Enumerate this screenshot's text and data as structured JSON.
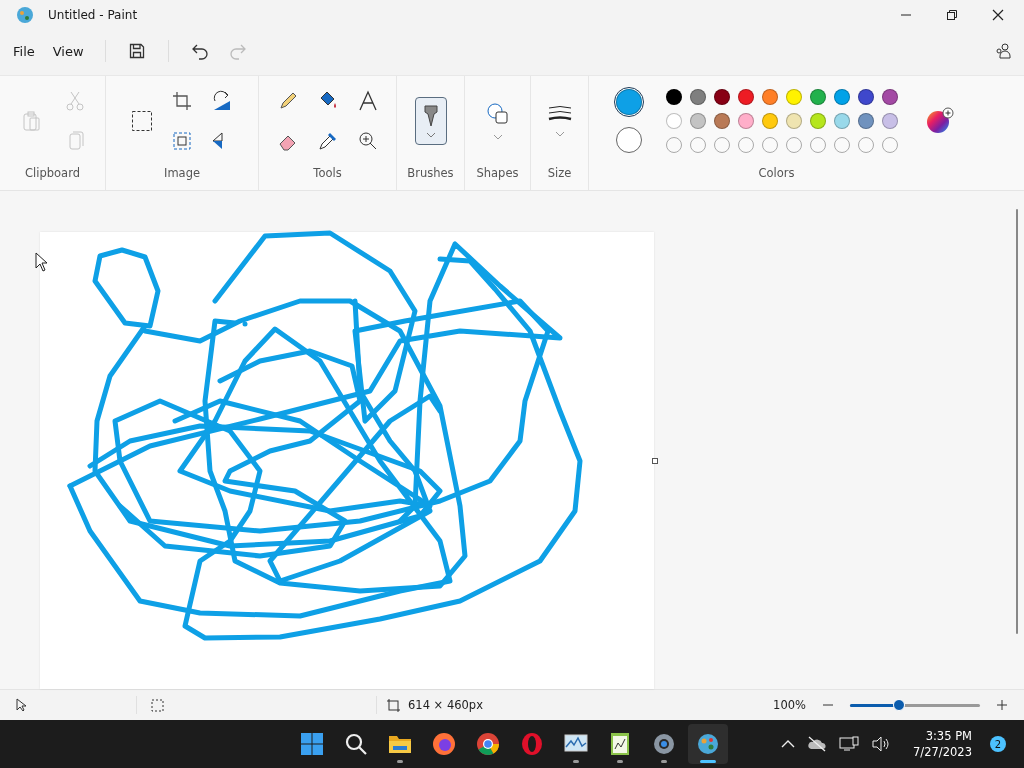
{
  "window": {
    "title": "Untitled - Paint"
  },
  "menu": [
    {
      "label": "File"
    },
    {
      "label": "View"
    }
  ],
  "quick_access": [
    {
      "kind": "save",
      "disabled": false
    },
    {
      "kind": "undo",
      "disabled": false
    },
    {
      "kind": "redo",
      "disabled": true
    }
  ],
  "ribbon": [
    {
      "label": "Clipboard",
      "kind": "clipboard",
      "tools": [
        {
          "kind": "paste",
          "disabled": true
        },
        {
          "kind": "cut",
          "disabled": true
        },
        {
          "kind": "copy",
          "disabled": true
        }
      ]
    },
    {
      "label": "Image",
      "kind": "image",
      "tools": [
        {
          "kind": "select"
        },
        {
          "kind": "crop"
        },
        {
          "kind": "rotate"
        },
        {
          "kind": "resize"
        },
        {
          "kind": "flip"
        }
      ]
    },
    {
      "label": "Tools",
      "kind": "tools",
      "tools": [
        {
          "kind": "pencil"
        },
        {
          "kind": "fill"
        },
        {
          "kind": "text"
        },
        {
          "kind": "eraser"
        },
        {
          "kind": "picker"
        },
        {
          "kind": "magnifier"
        }
      ]
    },
    {
      "label": "Brushes",
      "kind": "brushes",
      "selected": true
    },
    {
      "label": "Shapes",
      "kind": "shapes"
    },
    {
      "label": "Size",
      "kind": "size"
    },
    {
      "label": "Colors",
      "kind": "colors"
    }
  ],
  "colors": {
    "current": [
      {
        "color": "#0ea0e6",
        "selected": true
      },
      {
        "color": "#ffffff",
        "selected": false
      }
    ],
    "palette": [
      {
        "color": "#000000"
      },
      {
        "color": "#7f7f7f"
      },
      {
        "color": "#880015"
      },
      {
        "color": "#ed1c24"
      },
      {
        "color": "#ff7f27"
      },
      {
        "color": "#fff200"
      },
      {
        "color": "#22b14c"
      },
      {
        "color": "#00a2e8"
      },
      {
        "color": "#3f48cc"
      },
      {
        "color": "#a349a4"
      },
      {
        "color": "#ffffff"
      },
      {
        "color": "#c3c3c3"
      },
      {
        "color": "#b97a57"
      },
      {
        "color": "#ffaec9"
      },
      {
        "color": "#ffc90e"
      },
      {
        "color": "#efe4b0"
      },
      {
        "color": "#b5e61d"
      },
      {
        "color": "#99d9ea"
      },
      {
        "color": "#7092be"
      },
      {
        "color": "#c8bfe7"
      }
    ],
    "custom_slots": [
      {
        "kind": "empty"
      },
      {
        "kind": "empty"
      },
      {
        "kind": "empty"
      },
      {
        "kind": "empty"
      },
      {
        "kind": "empty"
      },
      {
        "kind": "empty"
      },
      {
        "kind": "empty"
      },
      {
        "kind": "empty"
      },
      {
        "kind": "empty"
      },
      {
        "kind": "empty"
      }
    ]
  },
  "status_bar": {
    "canvas_size": "614 × 460px",
    "zoom": "100%",
    "zoom_slider": {
      "level": 0.38
    }
  },
  "taskbar": {
    "apps": [
      {
        "kind": "start",
        "running": false,
        "active": false
      },
      {
        "kind": "search",
        "running": false,
        "active": false
      },
      {
        "kind": "folder",
        "running": true,
        "active": false
      },
      {
        "kind": "firefox",
        "running": false,
        "active": false
      },
      {
        "kind": "chrome",
        "running": false,
        "active": false
      },
      {
        "kind": "opera",
        "running": false,
        "active": false
      },
      {
        "kind": "monitor",
        "running": true,
        "active": false
      },
      {
        "kind": "notepad",
        "running": true,
        "active": false
      },
      {
        "kind": "settings",
        "running": true,
        "active": false
      },
      {
        "kind": "paint",
        "running": true,
        "active": true
      }
    ],
    "time": "3:35 PM",
    "date": "7/27/2023",
    "notifications": "2"
  }
}
